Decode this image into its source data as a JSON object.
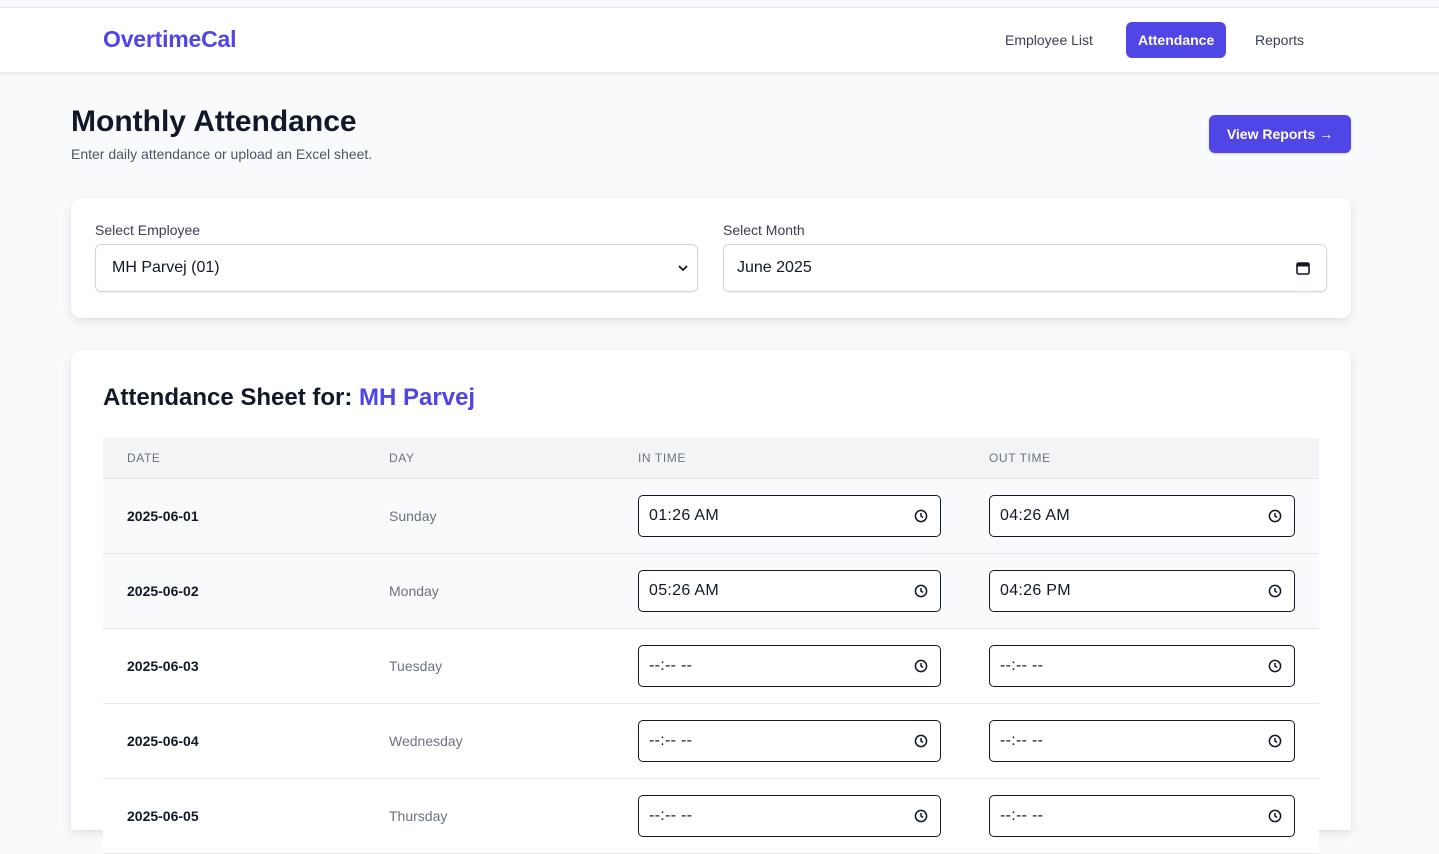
{
  "nav": {
    "brand": "OvertimeCal",
    "links": [
      "Employee List",
      "Attendance",
      "Reports"
    ],
    "active": "Attendance"
  },
  "header": {
    "title": "Monthly Attendance",
    "subtitle": "Enter daily attendance or upload an Excel sheet.",
    "reports_button": "View Reports →"
  },
  "filters": {
    "employee_label": "Select Employee",
    "employee_value": "MH Parvej (01)",
    "month_label": "Select Month",
    "month_value": "June 2025"
  },
  "sheet": {
    "title_prefix": "Attendance Sheet for:",
    "employee_name": "MH Parvej",
    "columns": [
      "DATE",
      "DAY",
      "IN TIME",
      "OUT TIME"
    ],
    "rows": [
      {
        "date": "2025-06-01",
        "day": "Sunday",
        "in": "01:26 AM",
        "out": "04:26 AM"
      },
      {
        "date": "2025-06-02",
        "day": "Monday",
        "in": "05:26 AM",
        "out": "04:26 PM"
      },
      {
        "date": "2025-06-03",
        "day": "Tuesday",
        "in": "--:-- --",
        "out": "--:-- --"
      },
      {
        "date": "2025-06-04",
        "day": "Wednesday",
        "in": "--:-- --",
        "out": "--:-- --"
      },
      {
        "date": "2025-06-05",
        "day": "Thursday",
        "in": "--:-- --",
        "out": "--:-- --"
      }
    ]
  },
  "colors": {
    "accent": "#4f46e5",
    "text": "#111827",
    "muted": "#6b7280",
    "background": "#f9fafb"
  },
  "icons": {
    "select": "chevron-down-icon",
    "month": "calendar-icon",
    "time": "clock-icon"
  }
}
